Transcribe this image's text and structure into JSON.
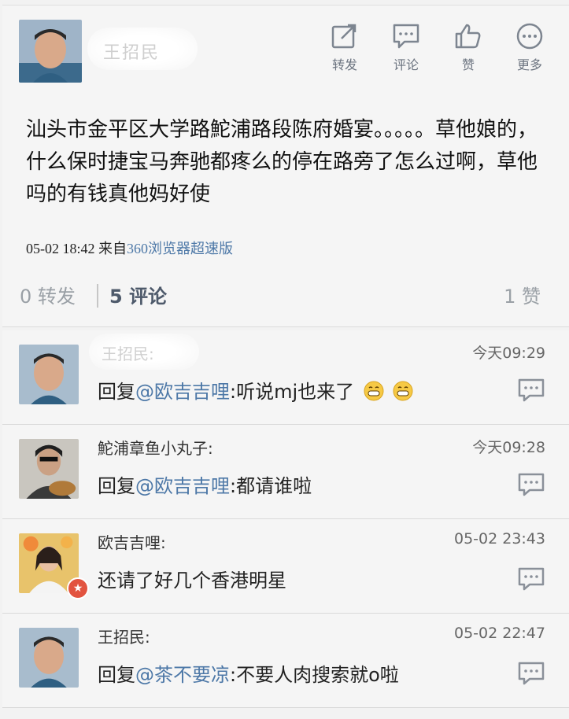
{
  "post": {
    "author": "王招民",
    "text": "汕头市金平区大学路鮀浦路段陈府婚宴。。。。。草他娘的，什么保时捷宝马奔驰都疼么的停在路旁了怎么过啊，草他吗的有钱真他妈好使",
    "time": "05-02 18:42",
    "via": "来自",
    "source": "360浏览器超速版",
    "actions": {
      "repost": "转发",
      "comment": "评论",
      "like": "赞",
      "more": "更多"
    },
    "stats": {
      "reposts": "0 转发",
      "comments": "5 评论",
      "likes": "1 赞"
    }
  },
  "comments": [
    {
      "name": "王招民:",
      "time": "今天09:29",
      "prefix": "回复",
      "mention": "@欧吉吉哩",
      "body": ":听说mj也来了",
      "emoji": "grinning-face-icon",
      "avatar": "young-man-avatar"
    },
    {
      "name": "鮀浦章鱼小丸子:",
      "time": "今天09:28",
      "prefix": "回复",
      "mention": "@欧吉吉哩",
      "body": ":都请谁啦",
      "avatar": "guitar-player-avatar"
    },
    {
      "name": "欧吉吉哩:",
      "time": "05-02 23:43",
      "prefix": "",
      "mention": "",
      "body": "还请了好几个香港明星",
      "avatar": "girl-avatar",
      "badge": "star-badge-icon"
    },
    {
      "name": "王招民:",
      "time": "05-02 22:47",
      "prefix": "回复",
      "mention": "@茶不要凉",
      "body": ":不要人肉搜索就o啦",
      "avatar": "young-man-avatar"
    }
  ],
  "colors": {
    "link": "#4d78a7",
    "muted": "#9aa0a6",
    "badge": "#e2533f"
  }
}
